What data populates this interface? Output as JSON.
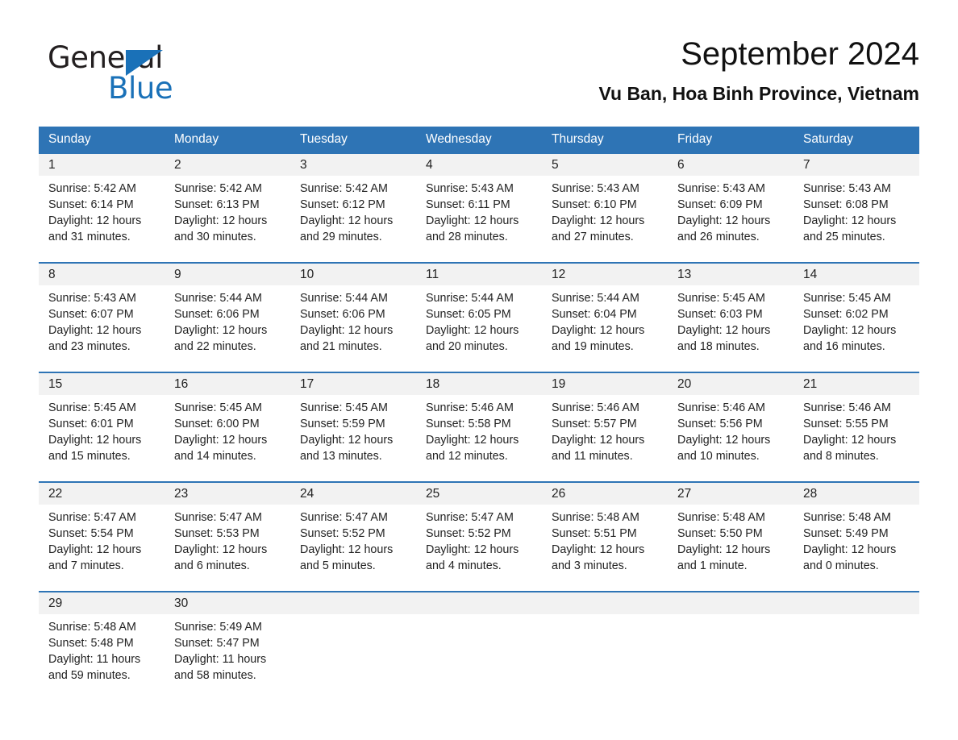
{
  "brand": {
    "name_part1": "General",
    "name_part2": "Blue",
    "logo_icon": "triangle-icon",
    "accent_color": "#1a71b8"
  },
  "header": {
    "month_title": "September 2024",
    "location": "Vu Ban, Hoa Binh Province, Vietnam"
  },
  "calendar": {
    "header_color": "#2e74b5",
    "date_strip_color": "#f2f2f2",
    "day_names": [
      "Sunday",
      "Monday",
      "Tuesday",
      "Wednesday",
      "Thursday",
      "Friday",
      "Saturday"
    ],
    "weeks": [
      [
        {
          "date": "1",
          "sunrise": "Sunrise: 5:42 AM",
          "sunset": "Sunset: 6:14 PM",
          "daylight_1": "Daylight: 12 hours",
          "daylight_2": "and 31 minutes."
        },
        {
          "date": "2",
          "sunrise": "Sunrise: 5:42 AM",
          "sunset": "Sunset: 6:13 PM",
          "daylight_1": "Daylight: 12 hours",
          "daylight_2": "and 30 minutes."
        },
        {
          "date": "3",
          "sunrise": "Sunrise: 5:42 AM",
          "sunset": "Sunset: 6:12 PM",
          "daylight_1": "Daylight: 12 hours",
          "daylight_2": "and 29 minutes."
        },
        {
          "date": "4",
          "sunrise": "Sunrise: 5:43 AM",
          "sunset": "Sunset: 6:11 PM",
          "daylight_1": "Daylight: 12 hours",
          "daylight_2": "and 28 minutes."
        },
        {
          "date": "5",
          "sunrise": "Sunrise: 5:43 AM",
          "sunset": "Sunset: 6:10 PM",
          "daylight_1": "Daylight: 12 hours",
          "daylight_2": "and 27 minutes."
        },
        {
          "date": "6",
          "sunrise": "Sunrise: 5:43 AM",
          "sunset": "Sunset: 6:09 PM",
          "daylight_1": "Daylight: 12 hours",
          "daylight_2": "and 26 minutes."
        },
        {
          "date": "7",
          "sunrise": "Sunrise: 5:43 AM",
          "sunset": "Sunset: 6:08 PM",
          "daylight_1": "Daylight: 12 hours",
          "daylight_2": "and 25 minutes."
        }
      ],
      [
        {
          "date": "8",
          "sunrise": "Sunrise: 5:43 AM",
          "sunset": "Sunset: 6:07 PM",
          "daylight_1": "Daylight: 12 hours",
          "daylight_2": "and 23 minutes."
        },
        {
          "date": "9",
          "sunrise": "Sunrise: 5:44 AM",
          "sunset": "Sunset: 6:06 PM",
          "daylight_1": "Daylight: 12 hours",
          "daylight_2": "and 22 minutes."
        },
        {
          "date": "10",
          "sunrise": "Sunrise: 5:44 AM",
          "sunset": "Sunset: 6:06 PM",
          "daylight_1": "Daylight: 12 hours",
          "daylight_2": "and 21 minutes."
        },
        {
          "date": "11",
          "sunrise": "Sunrise: 5:44 AM",
          "sunset": "Sunset: 6:05 PM",
          "daylight_1": "Daylight: 12 hours",
          "daylight_2": "and 20 minutes."
        },
        {
          "date": "12",
          "sunrise": "Sunrise: 5:44 AM",
          "sunset": "Sunset: 6:04 PM",
          "daylight_1": "Daylight: 12 hours",
          "daylight_2": "and 19 minutes."
        },
        {
          "date": "13",
          "sunrise": "Sunrise: 5:45 AM",
          "sunset": "Sunset: 6:03 PM",
          "daylight_1": "Daylight: 12 hours",
          "daylight_2": "and 18 minutes."
        },
        {
          "date": "14",
          "sunrise": "Sunrise: 5:45 AM",
          "sunset": "Sunset: 6:02 PM",
          "daylight_1": "Daylight: 12 hours",
          "daylight_2": "and 16 minutes."
        }
      ],
      [
        {
          "date": "15",
          "sunrise": "Sunrise: 5:45 AM",
          "sunset": "Sunset: 6:01 PM",
          "daylight_1": "Daylight: 12 hours",
          "daylight_2": "and 15 minutes."
        },
        {
          "date": "16",
          "sunrise": "Sunrise: 5:45 AM",
          "sunset": "Sunset: 6:00 PM",
          "daylight_1": "Daylight: 12 hours",
          "daylight_2": "and 14 minutes."
        },
        {
          "date": "17",
          "sunrise": "Sunrise: 5:45 AM",
          "sunset": "Sunset: 5:59 PM",
          "daylight_1": "Daylight: 12 hours",
          "daylight_2": "and 13 minutes."
        },
        {
          "date": "18",
          "sunrise": "Sunrise: 5:46 AM",
          "sunset": "Sunset: 5:58 PM",
          "daylight_1": "Daylight: 12 hours",
          "daylight_2": "and 12 minutes."
        },
        {
          "date": "19",
          "sunrise": "Sunrise: 5:46 AM",
          "sunset": "Sunset: 5:57 PM",
          "daylight_1": "Daylight: 12 hours",
          "daylight_2": "and 11 minutes."
        },
        {
          "date": "20",
          "sunrise": "Sunrise: 5:46 AM",
          "sunset": "Sunset: 5:56 PM",
          "daylight_1": "Daylight: 12 hours",
          "daylight_2": "and 10 minutes."
        },
        {
          "date": "21",
          "sunrise": "Sunrise: 5:46 AM",
          "sunset": "Sunset: 5:55 PM",
          "daylight_1": "Daylight: 12 hours",
          "daylight_2": "and 8 minutes."
        }
      ],
      [
        {
          "date": "22",
          "sunrise": "Sunrise: 5:47 AM",
          "sunset": "Sunset: 5:54 PM",
          "daylight_1": "Daylight: 12 hours",
          "daylight_2": "and 7 minutes."
        },
        {
          "date": "23",
          "sunrise": "Sunrise: 5:47 AM",
          "sunset": "Sunset: 5:53 PM",
          "daylight_1": "Daylight: 12 hours",
          "daylight_2": "and 6 minutes."
        },
        {
          "date": "24",
          "sunrise": "Sunrise: 5:47 AM",
          "sunset": "Sunset: 5:52 PM",
          "daylight_1": "Daylight: 12 hours",
          "daylight_2": "and 5 minutes."
        },
        {
          "date": "25",
          "sunrise": "Sunrise: 5:47 AM",
          "sunset": "Sunset: 5:52 PM",
          "daylight_1": "Daylight: 12 hours",
          "daylight_2": "and 4 minutes."
        },
        {
          "date": "26",
          "sunrise": "Sunrise: 5:48 AM",
          "sunset": "Sunset: 5:51 PM",
          "daylight_1": "Daylight: 12 hours",
          "daylight_2": "and 3 minutes."
        },
        {
          "date": "27",
          "sunrise": "Sunrise: 5:48 AM",
          "sunset": "Sunset: 5:50 PM",
          "daylight_1": "Daylight: 12 hours",
          "daylight_2": "and 1 minute."
        },
        {
          "date": "28",
          "sunrise": "Sunrise: 5:48 AM",
          "sunset": "Sunset: 5:49 PM",
          "daylight_1": "Daylight: 12 hours",
          "daylight_2": "and 0 minutes."
        }
      ],
      [
        {
          "date": "29",
          "sunrise": "Sunrise: 5:48 AM",
          "sunset": "Sunset: 5:48 PM",
          "daylight_1": "Daylight: 11 hours",
          "daylight_2": "and 59 minutes."
        },
        {
          "date": "30",
          "sunrise": "Sunrise: 5:49 AM",
          "sunset": "Sunset: 5:47 PM",
          "daylight_1": "Daylight: 11 hours",
          "daylight_2": "and 58 minutes."
        },
        {
          "date": "",
          "sunrise": "",
          "sunset": "",
          "daylight_1": "",
          "daylight_2": ""
        },
        {
          "date": "",
          "sunrise": "",
          "sunset": "",
          "daylight_1": "",
          "daylight_2": ""
        },
        {
          "date": "",
          "sunrise": "",
          "sunset": "",
          "daylight_1": "",
          "daylight_2": ""
        },
        {
          "date": "",
          "sunrise": "",
          "sunset": "",
          "daylight_1": "",
          "daylight_2": ""
        },
        {
          "date": "",
          "sunrise": "",
          "sunset": "",
          "daylight_1": "",
          "daylight_2": ""
        }
      ]
    ]
  }
}
